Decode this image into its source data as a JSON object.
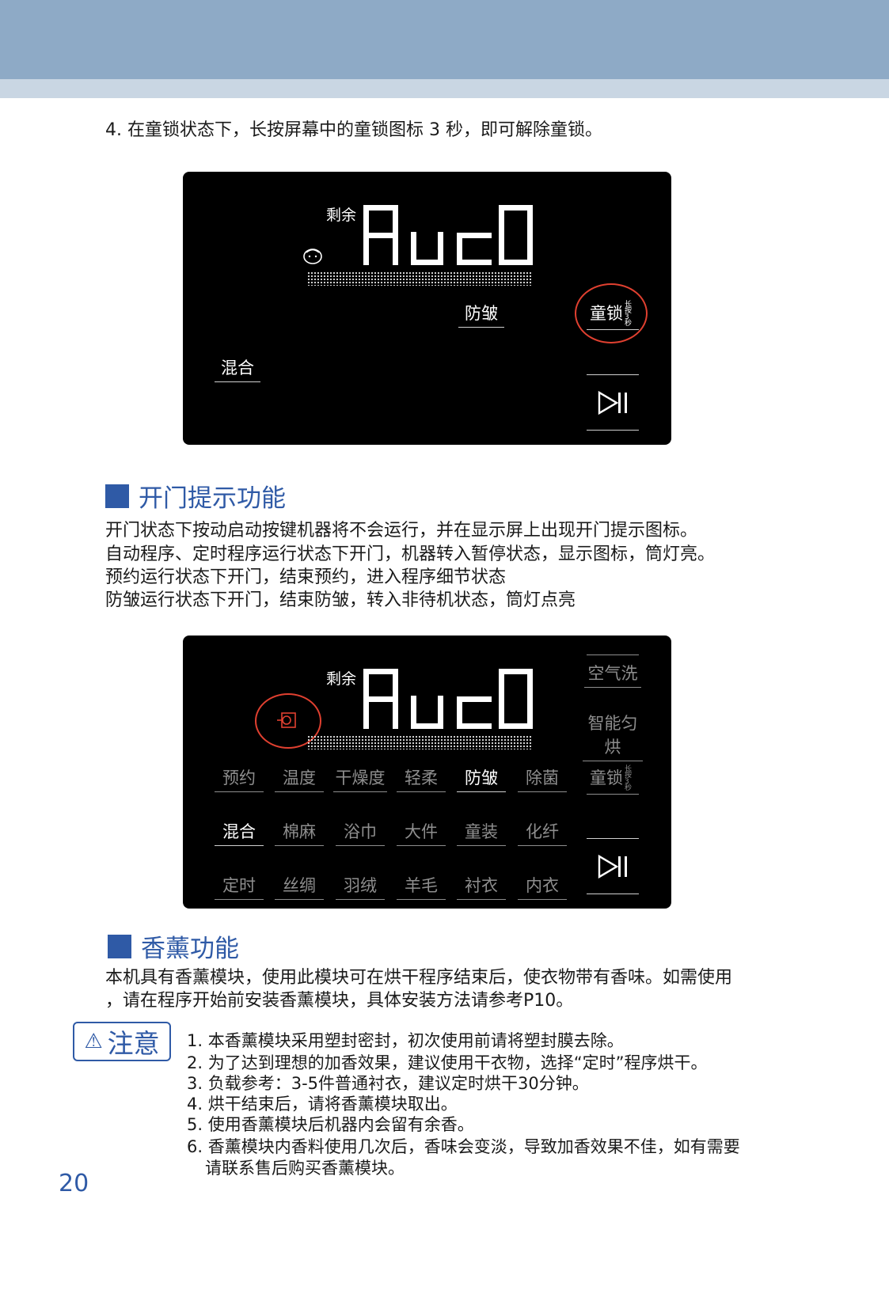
{
  "header_colors": {
    "band": "#8eaac6",
    "strip": "#c9d6e3",
    "accent": "#2f5aa6"
  },
  "intro_line": "4. 在童锁状态下，长按屏幕中的童锁图标 3 秒，即可解除童锁。",
  "panel1": {
    "display_text": "AUtO",
    "remaining_label": "剩余",
    "icon": "child-face-icon",
    "labels": {
      "anti_wrinkle": "防皱",
      "child_lock": "童锁",
      "child_lock_sup": "长按3秒",
      "mixed": "混合"
    },
    "play_icon": "play-pause-icon"
  },
  "section_door": {
    "title": "开门提示功能",
    "lines": [
      "开门状态下按动启动按键机器将不会运行，并在显示屏上出现开门提示图标。",
      "自动程序、定时程序运行状态下开门，机器转入暂停状态，显示图标，筒灯亮。",
      "预约运行状态下开门，结束预约，进入程序细节状态",
      "防皱运行状态下开门，结束防皱，转入非待机状态，筒灯点亮"
    ]
  },
  "panel2": {
    "display_text": "AUtO",
    "remaining_label": "剩余",
    "icon": "door-open-icon",
    "side": [
      "空气洗",
      "智能匀烘"
    ],
    "row1": [
      "预约",
      "温度",
      "干燥度",
      "轻柔",
      "防皱",
      "除菌"
    ],
    "child_lock": "童锁",
    "child_lock_sup": "长按3秒",
    "row2": [
      "混合",
      "棉麻",
      "浴巾",
      "大件",
      "童装",
      "化纤"
    ],
    "row3": [
      "定时",
      "丝绸",
      "羽绒",
      "羊毛",
      "衬衣",
      "内衣"
    ],
    "play_icon": "play-pause-icon"
  },
  "section_scent": {
    "title": "香薰功能",
    "lines": [
      "本机具有香薰模块，使用此模块可在烘干程序结束后，使衣物带有香味。如需使用",
      "，请在程序开始前安装香薰模块，具体安装方法请参考P10。"
    ]
  },
  "notice": {
    "label": "注意",
    "icon": "warning-icon",
    "items": [
      "1. 本香薰模块采用塑封密封，初次使用前请将塑封膜去除。",
      "2. 为了达到理想的加香效果，建议使用干衣物，选择“定时”程序烘干。",
      "3. 负载参考：3-5件普通衬衣，建议定时烘干30分钟。",
      "4. 烘干结束后，请将香薰模块取出。",
      "5. 使用香薰模块后机器内会留有余香。",
      "6. 香薰模块内香料使用几次后，香味会变淡，导致加香效果不佳，如有需要",
      "请联系售后购买香薰模块。"
    ]
  },
  "page_number": "20"
}
